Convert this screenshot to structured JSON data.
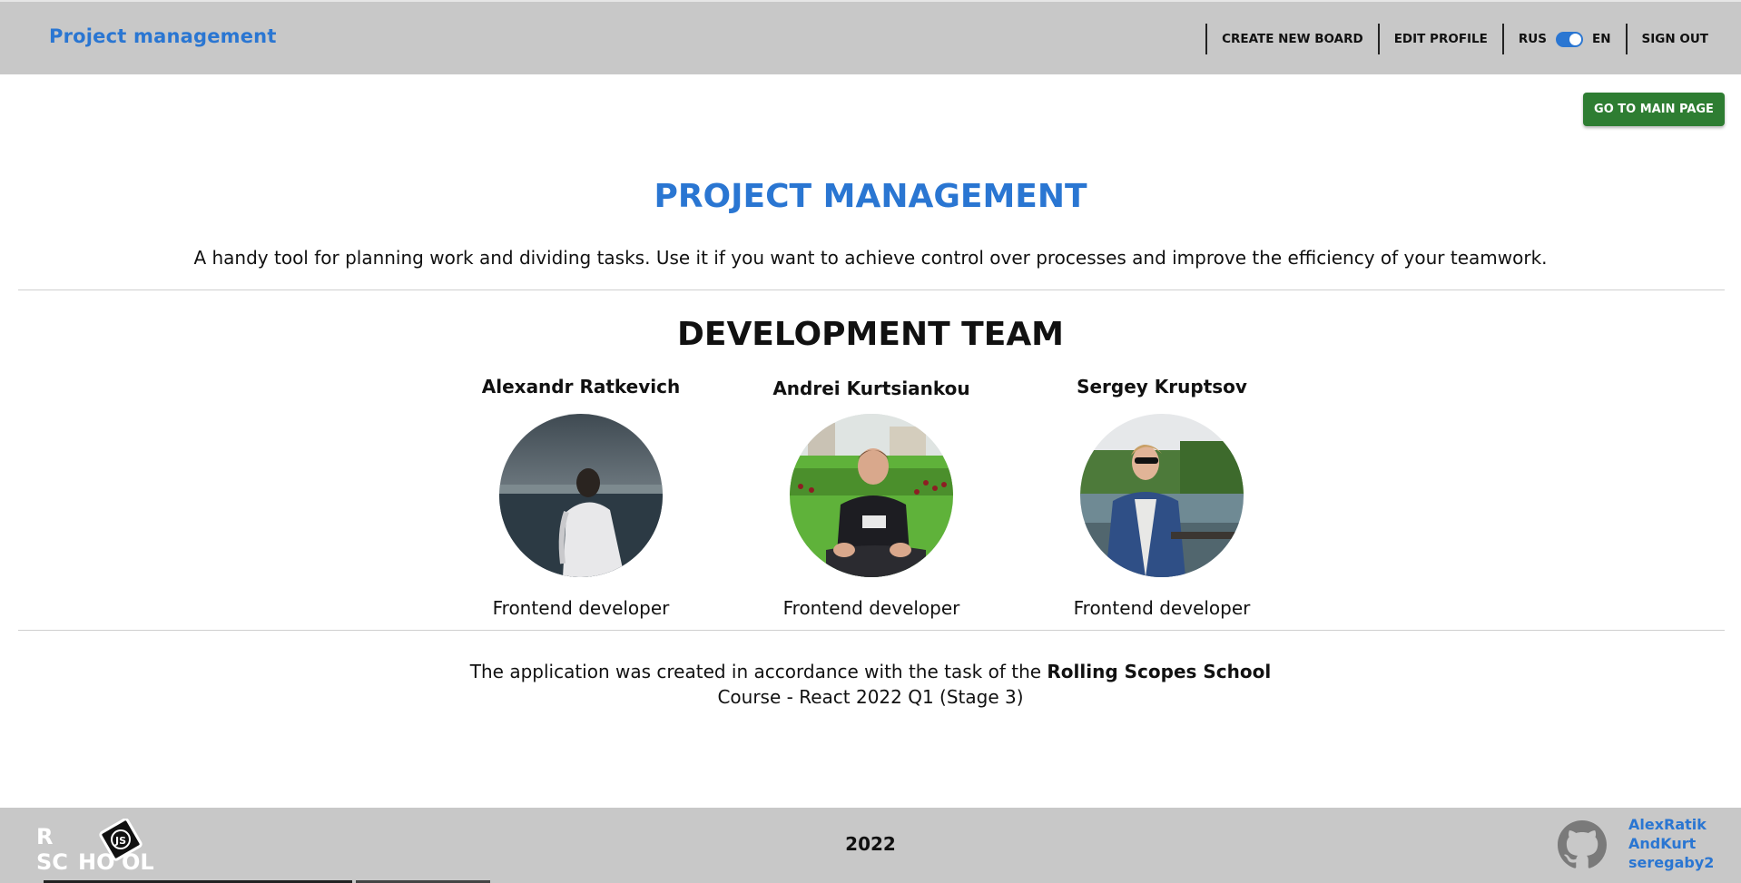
{
  "header": {
    "brand": "Project management",
    "nav": {
      "create_board": "CREATE NEW BOARD",
      "edit_profile": "EDIT PROFILE",
      "lang_left": "RUS",
      "lang_right": "EN",
      "sign_out": "SIGN OUT"
    }
  },
  "actions": {
    "go_main": "GO TO MAIN PAGE"
  },
  "hero": {
    "title": "PROJECT MANAGEMENT",
    "description": "A handy tool for planning work and dividing tasks. Use it if you want to achieve control over processes and improve the efficiency of your teamwork."
  },
  "team": {
    "title": "DEVELOPMENT TEAM",
    "members": [
      {
        "name": "Alexandr Ratkevich",
        "role": "Frontend developer"
      },
      {
        "name": "Andrei Kurtsiankou",
        "role": "Frontend developer"
      },
      {
        "name": "Sergey Kruptsov",
        "role": "Frontend developer"
      }
    ]
  },
  "credit": {
    "line1_prefix": "The application was created in accordance with the task of the",
    "line1_bold": "Rolling Scopes School",
    "line2": "Course - React 2022 Q1 (Stage 3)"
  },
  "footer": {
    "logo_text": "RS SCHOOL",
    "year": "2022",
    "links": [
      "AlexRatik",
      "AndKurt",
      "seregaby2"
    ]
  },
  "colors": {
    "accent": "#2a76d2",
    "header_bg": "#c8c8c8",
    "button_green": "#2e7d32",
    "toggle_on": "#2a76d2"
  },
  "icons": [
    "github-icon",
    "rs-school-logo"
  ],
  "language_toggle": {
    "selected": "EN"
  }
}
